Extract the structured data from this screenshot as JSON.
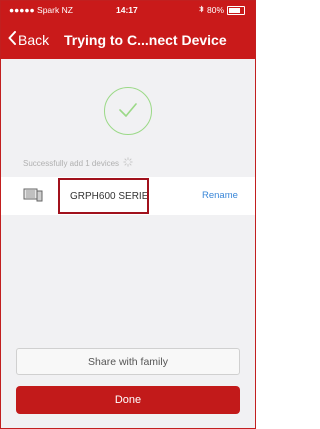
{
  "status_bar": {
    "carrier": "●●●●● Spark NZ",
    "time": "14:17",
    "battery": "80%"
  },
  "nav": {
    "back_label": "Back",
    "title": "Trying to C...nect Device"
  },
  "success": {
    "message": "Successfully add 1 devices"
  },
  "device": {
    "name": "GRPH600 SERIE...",
    "rename_label": "Rename"
  },
  "actions": {
    "share_label": "Share with family",
    "done_label": "Done"
  },
  "colors": {
    "brand_red": "#c91a1a",
    "success_green": "#9bd987",
    "link_blue": "#3a87d8"
  }
}
